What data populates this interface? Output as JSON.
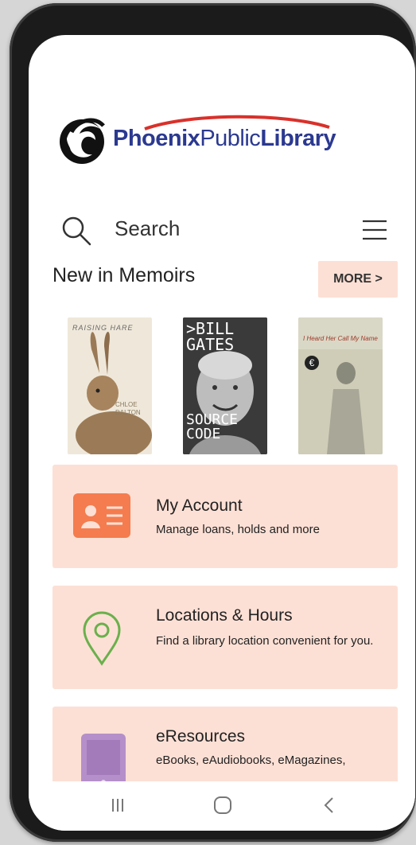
{
  "app": {
    "logo": {
      "part1": "Phoenix",
      "part2": "Public",
      "part3": "Library"
    }
  },
  "search": {
    "label": "Search",
    "icon": "search-icon"
  },
  "menu": {
    "icon": "hamburger-menu-icon"
  },
  "section": {
    "title": "New in Memoirs",
    "more_label": "MORE >"
  },
  "books": [
    {
      "cover_title": "RAISING HARE",
      "cover_author": "CHLOE\nDALTON",
      "color": "#efe8da"
    },
    {
      "cover_top": ">BILL\nGATES",
      "cover_bottom": "SOURCE\nCODE",
      "color": "#2a2a2a"
    },
    {
      "cover_title": "I Heard Her Call My Name",
      "color": "#d9d8c6"
    }
  ],
  "cards": [
    {
      "title": "My Account",
      "description": "Manage loans, holds and more",
      "icon": "id-card-icon",
      "icon_color": "#f47c4e"
    },
    {
      "title": "Locations & Hours",
      "description": "Find a library location convenient for you.",
      "icon": "location-pin-icon",
      "icon_color": "#6ab04c"
    },
    {
      "title": "eResources",
      "description": "eBooks, eAudiobooks, eMagazines,",
      "icon": "tablet-icon",
      "icon_color": "#b58fc9"
    }
  ],
  "nav": [
    {
      "icon": "recent-apps-icon"
    },
    {
      "icon": "home-icon"
    },
    {
      "icon": "back-icon"
    }
  ],
  "colors": {
    "brand": "#2b3990",
    "card_bg": "#fde0d5",
    "accent_red": "#d9312b"
  }
}
